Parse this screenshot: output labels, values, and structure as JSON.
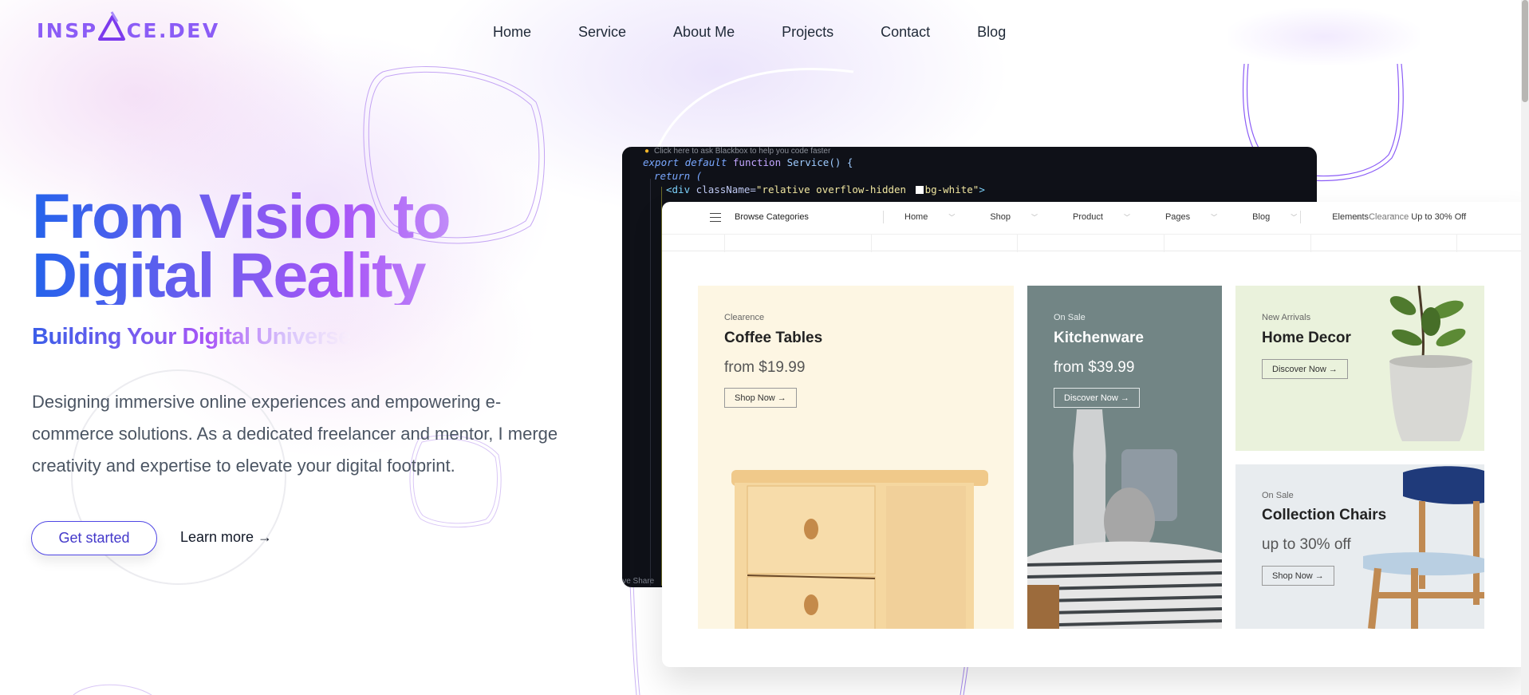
{
  "header": {
    "logo_text_left": "INSP",
    "logo_text_right": "CE.DEV",
    "nav": [
      "Home",
      "Service",
      "About Me",
      "Projects",
      "Contact",
      "Blog"
    ]
  },
  "hero": {
    "title_line1": "From Vision to",
    "title_line2": "Digital Reality",
    "subtitle": "Building Your Digital Universe",
    "description": "Designing immersive online experiences and empowering e-commerce solutions. As a dedicated freelancer and mentor, I merge creativity and expertise to elevate your digital footprint.",
    "primary_button": "Get started",
    "secondary_link": "Learn more →"
  },
  "editor": {
    "hint": "Click here to ask Blackbox to help you code faster",
    "line1_kw": "export default",
    "line1_fn": "function",
    "line1_name": "Service",
    "line1_tail": "() {",
    "line2": "return (",
    "line3_tag": "<div",
    "line3_attr": "className=",
    "line3_str_a": "\"relative overflow-hidden ",
    "line3_str_b": "bg-white\"",
    "line3_close": ">",
    "status": "ive Share"
  },
  "shop": {
    "browse": "Browse Categories",
    "menu": [
      {
        "label": "Home",
        "active": true
      },
      {
        "label": "Shop",
        "active": false
      },
      {
        "label": "Product",
        "active": false
      },
      {
        "label": "Pages",
        "active": false
      },
      {
        "label": "Blog",
        "active": false
      },
      {
        "label": "Elements",
        "active": false
      }
    ],
    "clearance_label": "Clearance",
    "clearance_offer": "Up to 30% Off",
    "cards": [
      {
        "eyebrow": "Clearence",
        "title": "Coffee Tables",
        "price": "from $19.99",
        "cta": "Shop Now  →"
      },
      {
        "eyebrow": "On Sale",
        "title": "Kitchenware",
        "price": "from $39.99",
        "cta": "Discover Now  →"
      },
      {
        "eyebrow": "New Arrivals",
        "title": "Home Decor",
        "cta": "Discover Now  →"
      },
      {
        "eyebrow": "On Sale",
        "title": "Collection Chairs",
        "price": "up to 30% off",
        "cta": "Shop Now  →"
      }
    ]
  },
  "colors": {
    "brand": "#8b5cf6",
    "title_gradient_start": "#2563eb",
    "title_gradient_end": "#c79af8",
    "primary_button": "#4f46e5",
    "shop_active": "#8fb45a"
  }
}
